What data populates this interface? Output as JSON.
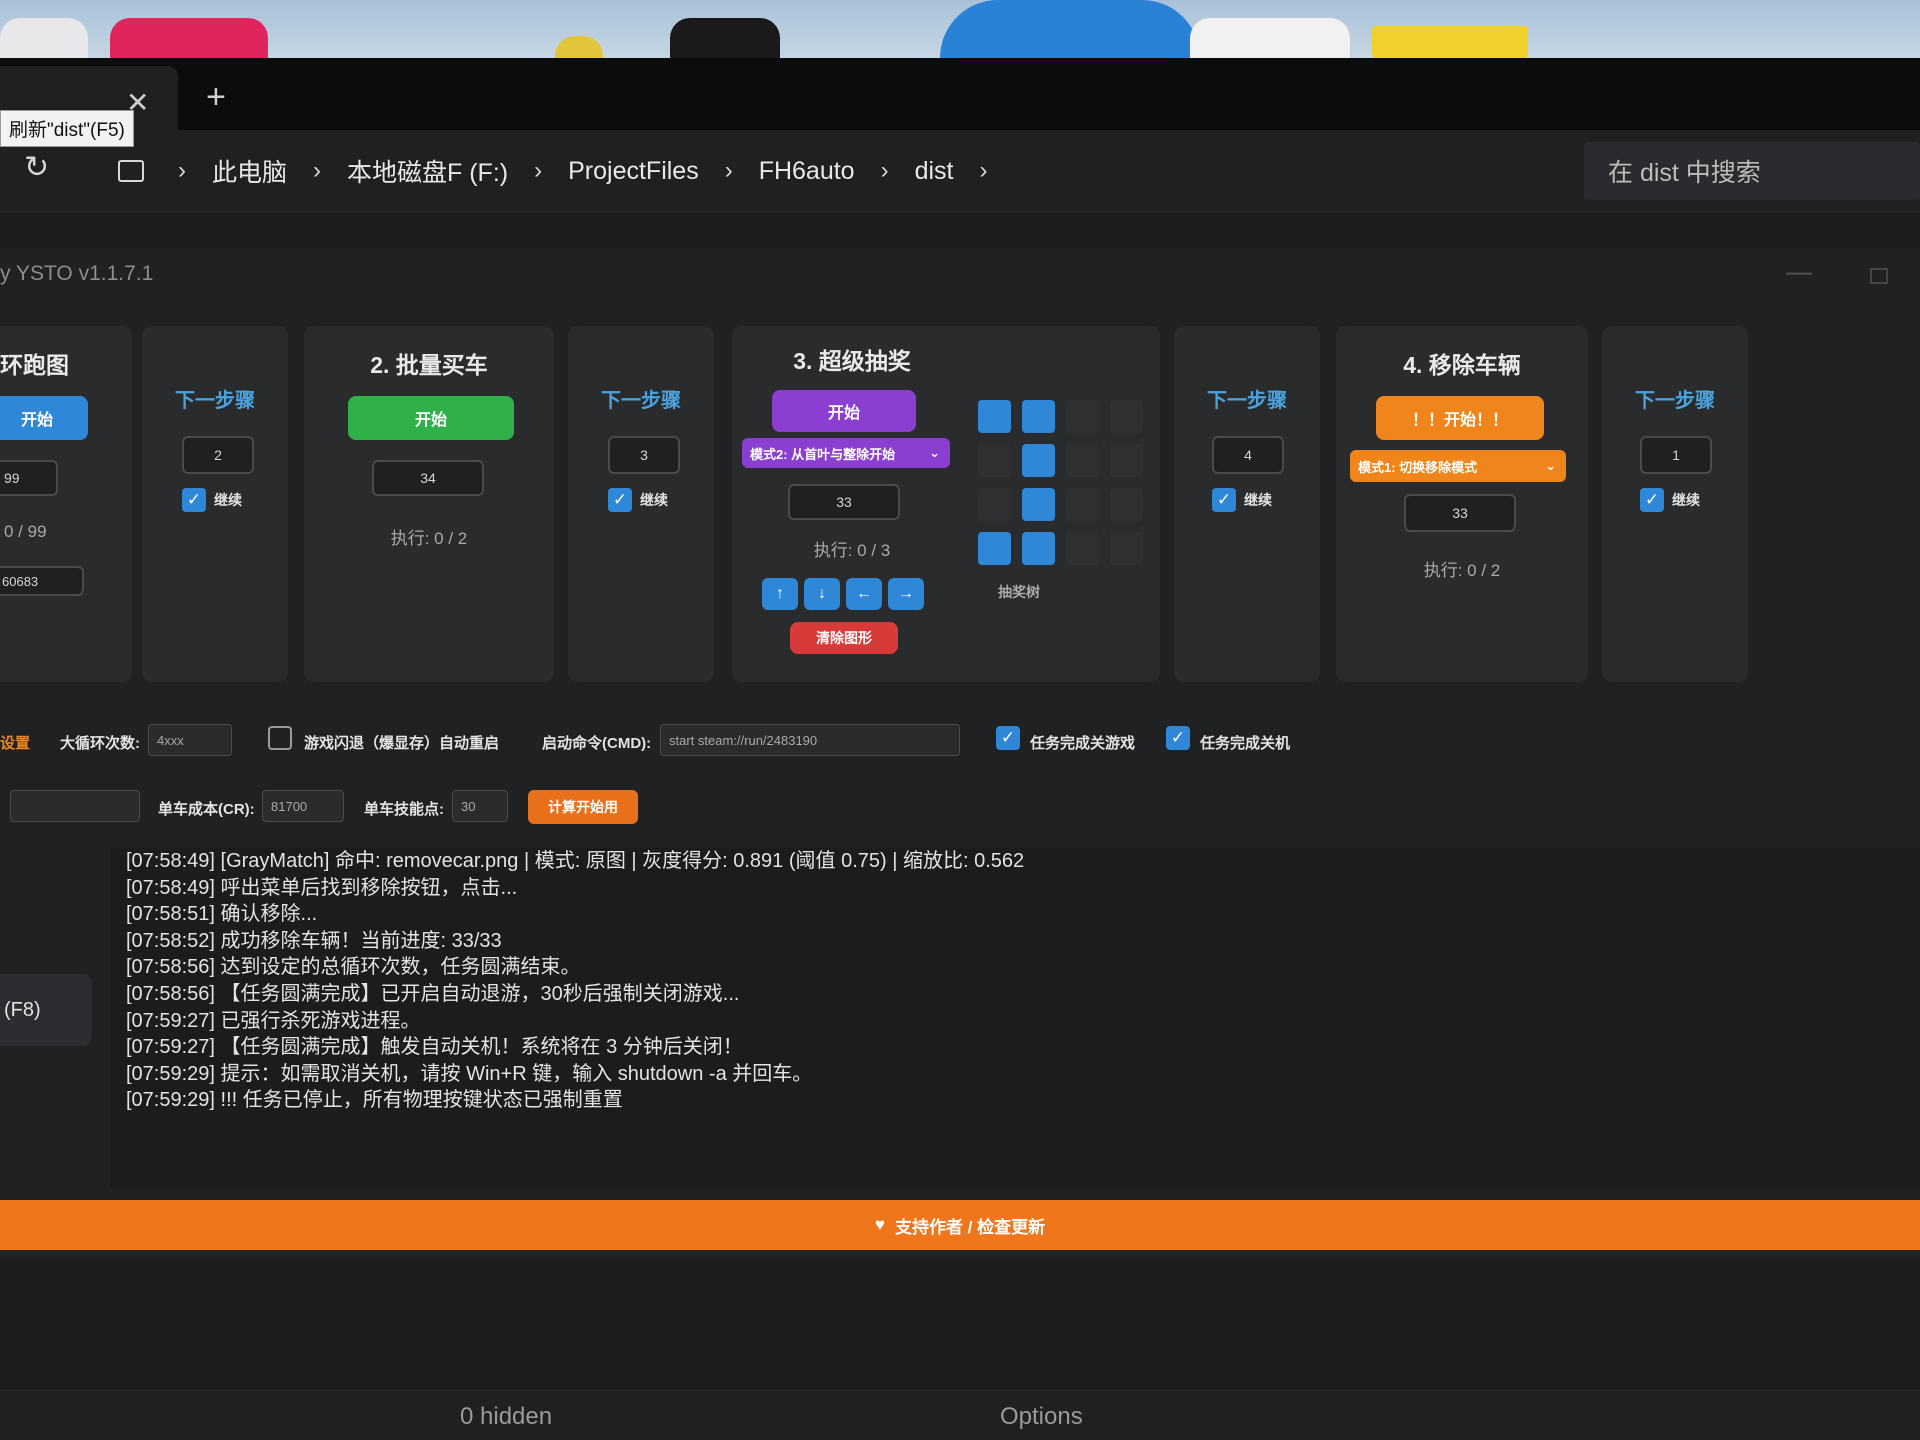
{
  "explorer": {
    "tooltip": "刷新\"dist\"(F5)",
    "breadcrumb": [
      "此电脑",
      "本地磁盘F (F:)",
      "ProjectFiles",
      "FH6auto",
      "dist"
    ],
    "search_placeholder": "在 dist 中搜索",
    "status_hidden": "0 hidden",
    "status_options": "Options"
  },
  "app": {
    "title": "y YSTO v1.1.7.1",
    "card1": {
      "title": "环跑图",
      "start_label": "开始",
      "input": "99",
      "progress": "0 / 99",
      "id": "60683"
    },
    "next1": {
      "title": "下一步骤",
      "value": "2",
      "check_label": "继续"
    },
    "card2": {
      "title": "2. 批量买车",
      "start_label": "开始",
      "input": "34",
      "exec": "执行: 0 / 2"
    },
    "next2": {
      "title": "下一步骤",
      "value": "3",
      "check_label": "继续"
    },
    "card3": {
      "title": "3. 超级抽奖",
      "start_label": "开始",
      "mode": "模式2: 从首叶与整除开始",
      "input": "33",
      "exec": "执行: 0 / 3",
      "clear_label": "清除图形",
      "grid_label": "抽奖树"
    },
    "next3": {
      "title": "下一步骤",
      "value": "4",
      "check_label": "继续"
    },
    "card4": {
      "title": "4. 移除车辆",
      "start_label": "！！开始！！",
      "mode": "模式1: 切换移除模式",
      "input": "33",
      "exec": "执行: 0 / 2"
    },
    "next4": {
      "title": "下一步骤",
      "value": "1",
      "check_label": "继续"
    },
    "config": {
      "left_label": "设置",
      "loops_label": "大循环次数:",
      "loops_value": "4xxx",
      "crash_label": "游戏闪退（爆显存）自动重启",
      "cmd_label": "启动命令(CMD):",
      "cmd_value": "start steam://run/2483190",
      "close_game_label": "任务完成关游戏",
      "shutdown_label": "任务完成关机",
      "cost_label": "单车成本(CR):",
      "cost_value": "81700",
      "points_label": "单车技能点:",
      "points_value": "30",
      "calc_label": "计算开始用"
    },
    "log": [
      "[07:58:49] [GrayMatch] 命中: removecar.png | 模式: 原图 | 灰度得分: 0.891 (阈值 0.75) | 缩放比: 0.562",
      "[07:58:49] 呼出菜单后找到移除按钮，点击...",
      "[07:58:51] 确认移除...",
      "[07:58:52] 成功移除车辆！当前进度: 33/33",
      "[07:58:56] 达到设定的总循环次数，任务圆满结束。",
      "[07:58:56] 【任务圆满完成】已开启自动退游，30秒后强制关闭游戏...",
      "[07:59:27] 已强行杀死游戏进程。",
      "[07:59:27] 【任务圆满完成】触发自动关机！系统将在 3 分钟后关闭！",
      "[07:59:29] 提示：如需取消关机，请按 Win+R 键，输入 shutdown -a 并回车。",
      "[07:59:29] !!! 任务已停止，所有物理按键状态已强制重置"
    ],
    "f8_label": "(F8)",
    "support_label": "支持作者 / 检查更新"
  },
  "colors": {
    "blue": "#2f87d8",
    "green": "#2fb04a",
    "purple": "#8a3fd1",
    "orange": "#f0861b",
    "red": "#d83a3a"
  }
}
